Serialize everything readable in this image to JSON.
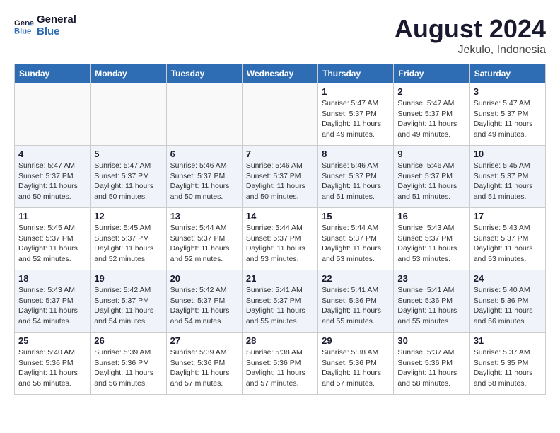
{
  "header": {
    "logo_line1": "General",
    "logo_line2": "Blue",
    "month_year": "August 2024",
    "location": "Jekulo, Indonesia"
  },
  "weekdays": [
    "Sunday",
    "Monday",
    "Tuesday",
    "Wednesday",
    "Thursday",
    "Friday",
    "Saturday"
  ],
  "weeks": [
    [
      {
        "day": "",
        "info": ""
      },
      {
        "day": "",
        "info": ""
      },
      {
        "day": "",
        "info": ""
      },
      {
        "day": "",
        "info": ""
      },
      {
        "day": "1",
        "info": "Sunrise: 5:47 AM\nSunset: 5:37 PM\nDaylight: 11 hours and 49 minutes."
      },
      {
        "day": "2",
        "info": "Sunrise: 5:47 AM\nSunset: 5:37 PM\nDaylight: 11 hours and 49 minutes."
      },
      {
        "day": "3",
        "info": "Sunrise: 5:47 AM\nSunset: 5:37 PM\nDaylight: 11 hours and 49 minutes."
      }
    ],
    [
      {
        "day": "4",
        "info": "Sunrise: 5:47 AM\nSunset: 5:37 PM\nDaylight: 11 hours and 50 minutes."
      },
      {
        "day": "5",
        "info": "Sunrise: 5:47 AM\nSunset: 5:37 PM\nDaylight: 11 hours and 50 minutes."
      },
      {
        "day": "6",
        "info": "Sunrise: 5:46 AM\nSunset: 5:37 PM\nDaylight: 11 hours and 50 minutes."
      },
      {
        "day": "7",
        "info": "Sunrise: 5:46 AM\nSunset: 5:37 PM\nDaylight: 11 hours and 50 minutes."
      },
      {
        "day": "8",
        "info": "Sunrise: 5:46 AM\nSunset: 5:37 PM\nDaylight: 11 hours and 51 minutes."
      },
      {
        "day": "9",
        "info": "Sunrise: 5:46 AM\nSunset: 5:37 PM\nDaylight: 11 hours and 51 minutes."
      },
      {
        "day": "10",
        "info": "Sunrise: 5:45 AM\nSunset: 5:37 PM\nDaylight: 11 hours and 51 minutes."
      }
    ],
    [
      {
        "day": "11",
        "info": "Sunrise: 5:45 AM\nSunset: 5:37 PM\nDaylight: 11 hours and 52 minutes."
      },
      {
        "day": "12",
        "info": "Sunrise: 5:45 AM\nSunset: 5:37 PM\nDaylight: 11 hours and 52 minutes."
      },
      {
        "day": "13",
        "info": "Sunrise: 5:44 AM\nSunset: 5:37 PM\nDaylight: 11 hours and 52 minutes."
      },
      {
        "day": "14",
        "info": "Sunrise: 5:44 AM\nSunset: 5:37 PM\nDaylight: 11 hours and 53 minutes."
      },
      {
        "day": "15",
        "info": "Sunrise: 5:44 AM\nSunset: 5:37 PM\nDaylight: 11 hours and 53 minutes."
      },
      {
        "day": "16",
        "info": "Sunrise: 5:43 AM\nSunset: 5:37 PM\nDaylight: 11 hours and 53 minutes."
      },
      {
        "day": "17",
        "info": "Sunrise: 5:43 AM\nSunset: 5:37 PM\nDaylight: 11 hours and 53 minutes."
      }
    ],
    [
      {
        "day": "18",
        "info": "Sunrise: 5:43 AM\nSunset: 5:37 PM\nDaylight: 11 hours and 54 minutes."
      },
      {
        "day": "19",
        "info": "Sunrise: 5:42 AM\nSunset: 5:37 PM\nDaylight: 11 hours and 54 minutes."
      },
      {
        "day": "20",
        "info": "Sunrise: 5:42 AM\nSunset: 5:37 PM\nDaylight: 11 hours and 54 minutes."
      },
      {
        "day": "21",
        "info": "Sunrise: 5:41 AM\nSunset: 5:37 PM\nDaylight: 11 hours and 55 minutes."
      },
      {
        "day": "22",
        "info": "Sunrise: 5:41 AM\nSunset: 5:36 PM\nDaylight: 11 hours and 55 minutes."
      },
      {
        "day": "23",
        "info": "Sunrise: 5:41 AM\nSunset: 5:36 PM\nDaylight: 11 hours and 55 minutes."
      },
      {
        "day": "24",
        "info": "Sunrise: 5:40 AM\nSunset: 5:36 PM\nDaylight: 11 hours and 56 minutes."
      }
    ],
    [
      {
        "day": "25",
        "info": "Sunrise: 5:40 AM\nSunset: 5:36 PM\nDaylight: 11 hours and 56 minutes."
      },
      {
        "day": "26",
        "info": "Sunrise: 5:39 AM\nSunset: 5:36 PM\nDaylight: 11 hours and 56 minutes."
      },
      {
        "day": "27",
        "info": "Sunrise: 5:39 AM\nSunset: 5:36 PM\nDaylight: 11 hours and 57 minutes."
      },
      {
        "day": "28",
        "info": "Sunrise: 5:38 AM\nSunset: 5:36 PM\nDaylight: 11 hours and 57 minutes."
      },
      {
        "day": "29",
        "info": "Sunrise: 5:38 AM\nSunset: 5:36 PM\nDaylight: 11 hours and 57 minutes."
      },
      {
        "day": "30",
        "info": "Sunrise: 5:37 AM\nSunset: 5:36 PM\nDaylight: 11 hours and 58 minutes."
      },
      {
        "day": "31",
        "info": "Sunrise: 5:37 AM\nSunset: 5:35 PM\nDaylight: 11 hours and 58 minutes."
      }
    ]
  ]
}
